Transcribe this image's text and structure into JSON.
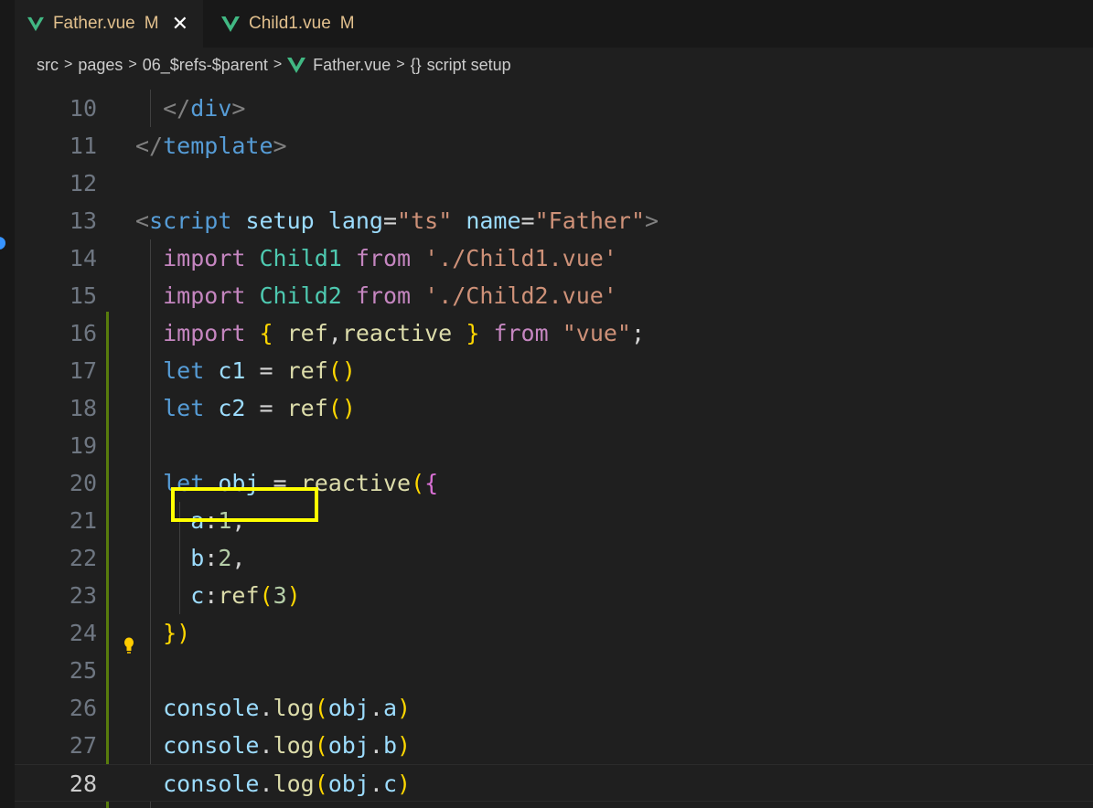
{
  "colors": {
    "modified": "#e2c08d",
    "change_bar": "#587c0c",
    "highlight": "#ffff00",
    "vue_green": "#41b883"
  },
  "tabs": [
    {
      "name": "Father.vue",
      "status": "M",
      "active": true,
      "icon": "vue-icon",
      "close": "✕"
    },
    {
      "name": "Child1.vue",
      "status": "M",
      "active": false,
      "icon": "vue-icon"
    }
  ],
  "breadcrumb": {
    "items": [
      "src",
      "pages",
      "06_$refs-$parent",
      "Father.vue",
      "script setup"
    ],
    "separator": ">",
    "symbol_icon": "{}"
  },
  "editor": {
    "current_line": 28,
    "lines": [
      {
        "n": "10",
        "text": "  </div>"
      },
      {
        "n": "11",
        "text": "</template>"
      },
      {
        "n": "12",
        "text": ""
      },
      {
        "n": "13",
        "text": "<script setup lang=\"ts\" name=\"Father\">"
      },
      {
        "n": "14",
        "text": "  import Child1 from './Child1.vue'"
      },
      {
        "n": "15",
        "text": "  import Child2 from './Child2.vue'"
      },
      {
        "n": "16",
        "text": "  import { ref,reactive } from \"vue\";"
      },
      {
        "n": "17",
        "text": "  let c1 = ref()"
      },
      {
        "n": "18",
        "text": "  let c2 = ref()"
      },
      {
        "n": "19",
        "text": ""
      },
      {
        "n": "20",
        "text": "  let obj = reactive({"
      },
      {
        "n": "21",
        "text": "    a:1,"
      },
      {
        "n": "22",
        "text": "    b:2,"
      },
      {
        "n": "23",
        "text": "    c:ref(3)"
      },
      {
        "n": "24",
        "text": "  })"
      },
      {
        "n": "25",
        "text": ""
      },
      {
        "n": "26",
        "text": "  console.log(obj.a)"
      },
      {
        "n": "27",
        "text": "  console.log(obj.b)"
      },
      {
        "n": "28",
        "text": "  console.log(obj.c)"
      }
    ],
    "highlighted_line": "23",
    "lightbulb_line": "27"
  }
}
